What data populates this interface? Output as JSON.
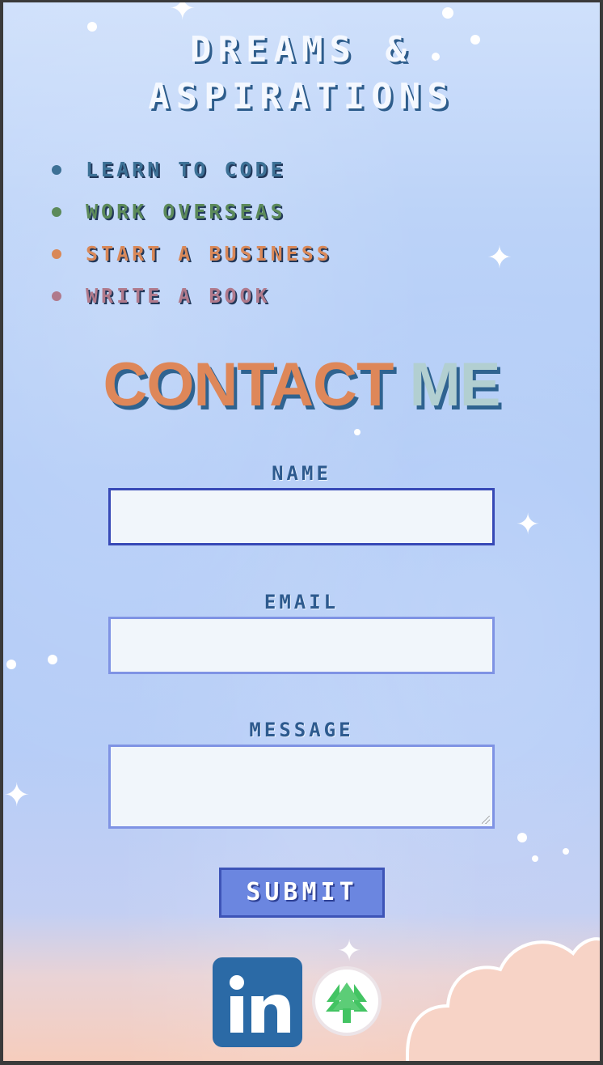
{
  "title": {
    "line1": "Dreams &",
    "line2": "Aspirations"
  },
  "goals": [
    {
      "label": "Learn to code",
      "color": "#3d7196",
      "bullet": "#3d7196"
    },
    {
      "label": "Work overseas",
      "color": "#5c8a5a",
      "bullet": "#5c8a5a"
    },
    {
      "label": "Start a business",
      "color": "#d98858",
      "bullet": "#d98858"
    },
    {
      "label": "Write a book",
      "color": "#b07a8c",
      "bullet": "#b07a8c"
    }
  ],
  "contact": {
    "word1": "CONTACT",
    "word2": "ME",
    "word1_color": "#de8759",
    "word2_color": "#b2cfd1"
  },
  "form": {
    "name_label": "Name",
    "name_value": "",
    "email_label": "Email",
    "email_value": "",
    "message_label": "Message",
    "message_value": "",
    "submit_label": "Submit"
  },
  "social": {
    "linkedin_icon": "linkedin-icon",
    "linkedin_color": "#2b6aa6",
    "linktree_icon": "linktree-icon",
    "linktree_color": "#43c463"
  }
}
